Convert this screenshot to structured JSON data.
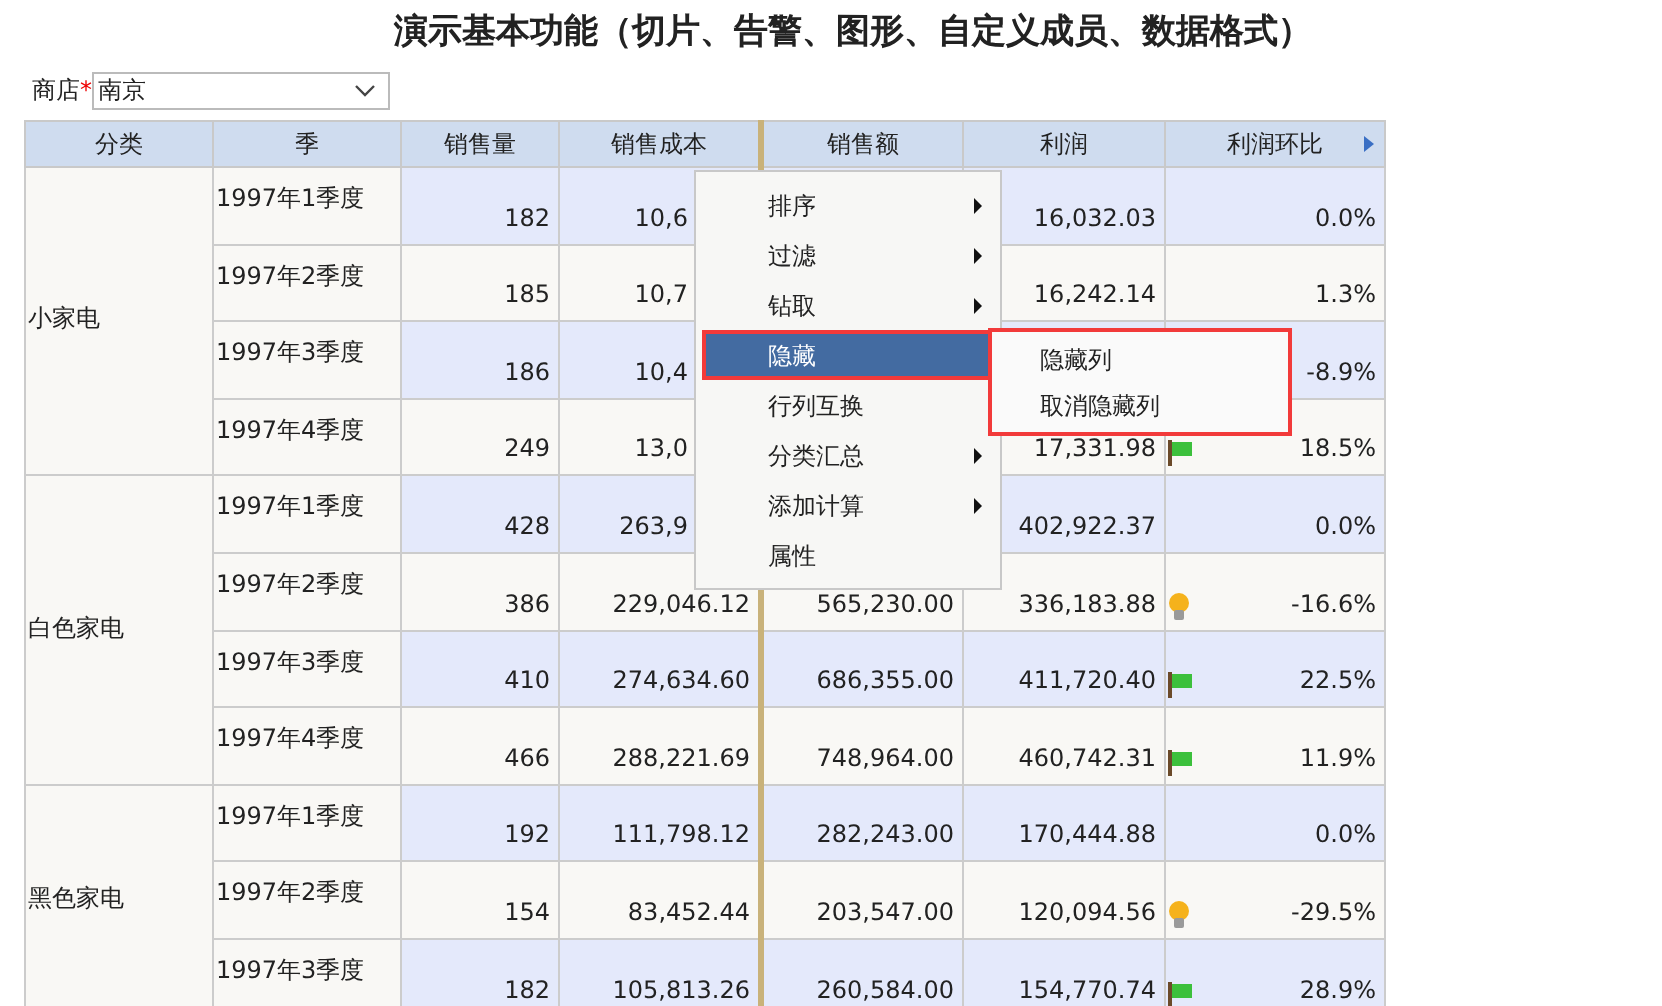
{
  "title": "演示基本功能（切片、告警、图形、自定义成员、数据格式）",
  "filter": {
    "label": "商店",
    "required_mark": "*",
    "value": "南京"
  },
  "table": {
    "columns": [
      "分类",
      "季",
      "销售量",
      "销售成本",
      "销售额",
      "利润",
      "利润环比"
    ],
    "groups": [
      {
        "category": "小家电",
        "rows": [
          {
            "season": "1997年1季度",
            "qty": "182",
            "cost": "10,6",
            "profit": "16,032.03",
            "ratio": "0.0%"
          },
          {
            "season": "1997年2季度",
            "qty": "185",
            "cost": "10,7",
            "profit": "16,242.14",
            "ratio": "1.3%"
          },
          {
            "season": "1997年3季度",
            "qty": "186",
            "cost": "10,4",
            "ratio": "-8.9%"
          },
          {
            "season": "1997年4季度",
            "qty": "249",
            "cost": "13,0",
            "profit": "17,331.98",
            "alert": {
              "kind": "flag"
            },
            "ratio": "18.5%"
          }
        ]
      },
      {
        "category": "白色家电",
        "rows": [
          {
            "season": "1997年1季度",
            "qty": "428",
            "cost": "263,9",
            "profit": "402,922.37",
            "ratio": "0.0%"
          },
          {
            "season": "1997年2季度",
            "qty": "386",
            "cost": "229,046.12",
            "sales": "565,230.00",
            "profit": "336,183.88",
            "alert": {
              "kind": "bulb"
            },
            "ratio": "-16.6%"
          },
          {
            "season": "1997年3季度",
            "qty": "410",
            "cost": "274,634.60",
            "sales": "686,355.00",
            "profit": "411,720.40",
            "alert": {
              "kind": "flag"
            },
            "ratio": "22.5%"
          },
          {
            "season": "1997年4季度",
            "qty": "466",
            "cost": "288,221.69",
            "sales": "748,964.00",
            "profit": "460,742.31",
            "alert": {
              "kind": "flag"
            },
            "ratio": "11.9%"
          }
        ]
      },
      {
        "category": "黑色家电",
        "rows": [
          {
            "season": "1997年1季度",
            "qty": "192",
            "cost": "111,798.12",
            "sales": "282,243.00",
            "profit": "170,444.88",
            "ratio": "0.0%"
          },
          {
            "season": "1997年2季度",
            "qty": "154",
            "cost": "83,452.44",
            "sales": "203,547.00",
            "profit": "120,094.56",
            "alert": {
              "kind": "bulb"
            },
            "ratio": "-29.5%"
          },
          {
            "season": "1997年3季度",
            "qty": "182",
            "cost": "105,813.26",
            "sales": "260,584.00",
            "profit": "154,770.74",
            "alert": {
              "kind": "flag"
            },
            "ratio": "28.9%"
          }
        ]
      }
    ]
  },
  "context_menu": {
    "items": [
      {
        "label": "排序",
        "has_submenu": true,
        "selected": false
      },
      {
        "label": "过滤",
        "has_submenu": true,
        "selected": false
      },
      {
        "label": "钻取",
        "has_submenu": true,
        "selected": false
      },
      {
        "label": "隐藏",
        "has_submenu": false,
        "selected": true
      },
      {
        "label": "行列互换",
        "has_submenu": false,
        "selected": false
      },
      {
        "label": "分类汇总",
        "has_submenu": true,
        "selected": false
      },
      {
        "label": "添加计算",
        "has_submenu": true,
        "selected": false
      },
      {
        "label": "属性",
        "has_submenu": false,
        "selected": false
      }
    ],
    "submenu": [
      "隐藏列",
      "取消隐藏列"
    ]
  }
}
